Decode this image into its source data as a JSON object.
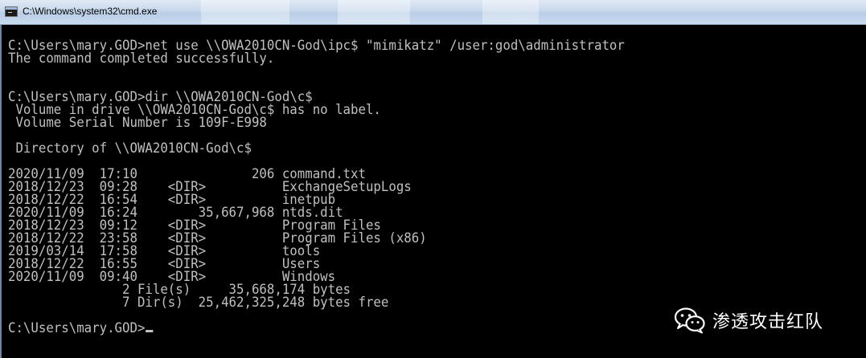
{
  "window": {
    "title": "C:\\Windows\\system32\\cmd.exe"
  },
  "console": {
    "lines": [
      "",
      "C:\\Users\\mary.GOD>net use \\\\OWA2010CN-God\\ipc$ \"mimikatz\" /user:god\\administrator",
      "The command completed successfully.",
      "",
      "",
      "C:\\Users\\mary.GOD>dir \\\\OWA2010CN-God\\c$",
      " Volume in drive \\\\OWA2010CN-God\\c$ has no label.",
      " Volume Serial Number is 109F-E998",
      "",
      " Directory of \\\\OWA2010CN-God\\c$",
      "",
      "2020/11/09  17:10               206 command.txt",
      "2018/12/23  09:28    <DIR>          ExchangeSetupLogs",
      "2018/12/22  16:54    <DIR>          inetpub",
      "2020/11/09  16:24        35,667,968 ntds.dit",
      "2018/12/23  09:12    <DIR>          Program Files",
      "2018/12/22  23:58    <DIR>          Program Files (x86)",
      "2019/03/14  17:58    <DIR>          tools",
      "2018/12/22  16:55    <DIR>          Users",
      "2020/11/09  09:40    <DIR>          Windows",
      "               2 File(s)     35,668,174 bytes",
      "               7 Dir(s)  25,462,325,248 bytes free",
      "",
      "C:\\Users\\mary.GOD>"
    ]
  },
  "watermark": {
    "text": "渗透攻击红队",
    "icon": "wechat-icon"
  },
  "colors": {
    "console_bg": "#000000",
    "console_fg": "#c0c0c0",
    "titlebar": "#c7d8ec"
  }
}
